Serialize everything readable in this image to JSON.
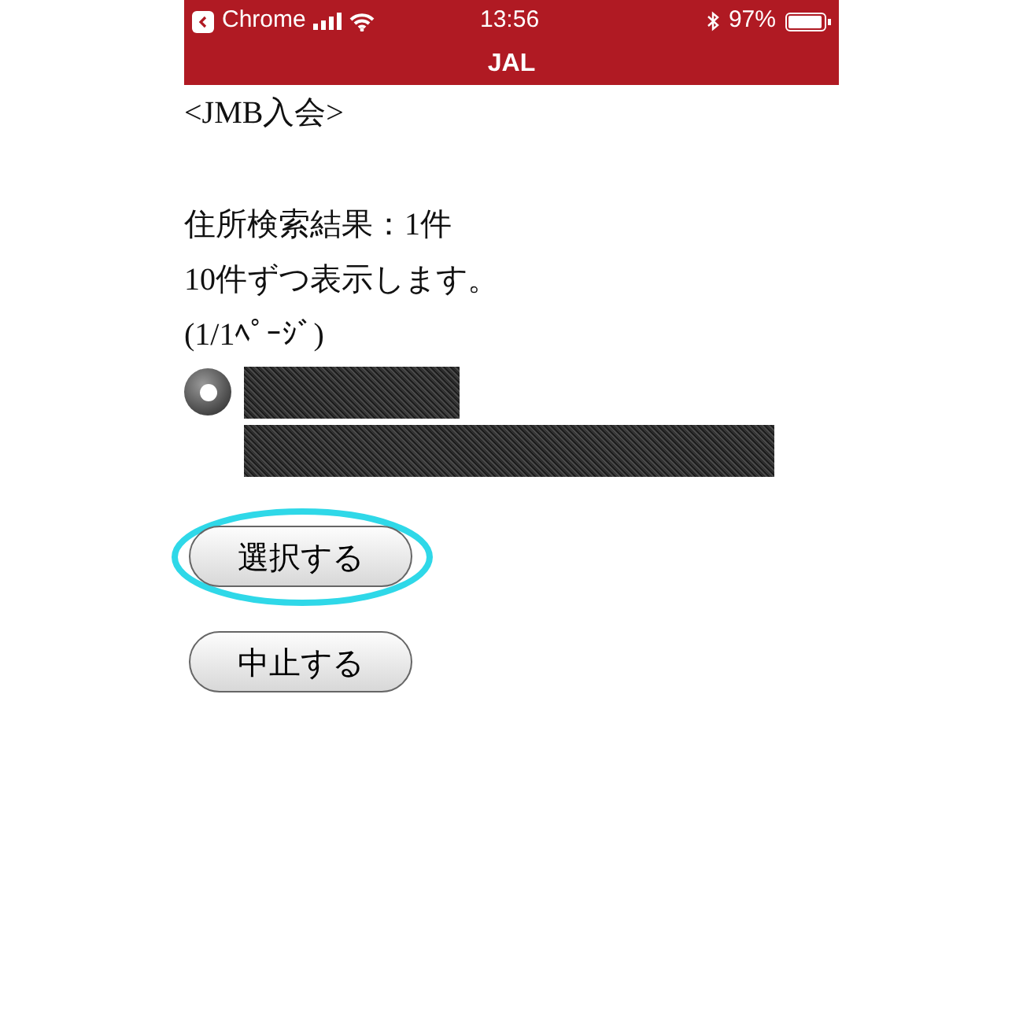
{
  "status_bar": {
    "back_app": "Chrome",
    "time": "13:56",
    "battery": "97%"
  },
  "title_bar": {
    "title": "JAL"
  },
  "heading": "<JMB入会>",
  "result_lines": [
    "住所検索結果：1件",
    "10件ずつ表示します。",
    "(1/1ﾍﾟｰｼﾞ)"
  ],
  "results": [
    {
      "selected": true,
      "redacted": [
        {
          "kind": "short"
        },
        {
          "kind": "long"
        }
      ]
    }
  ],
  "buttons": [
    {
      "label": "選択する",
      "highlighted": true
    },
    {
      "label": "中止する",
      "highlighted": false
    }
  ]
}
